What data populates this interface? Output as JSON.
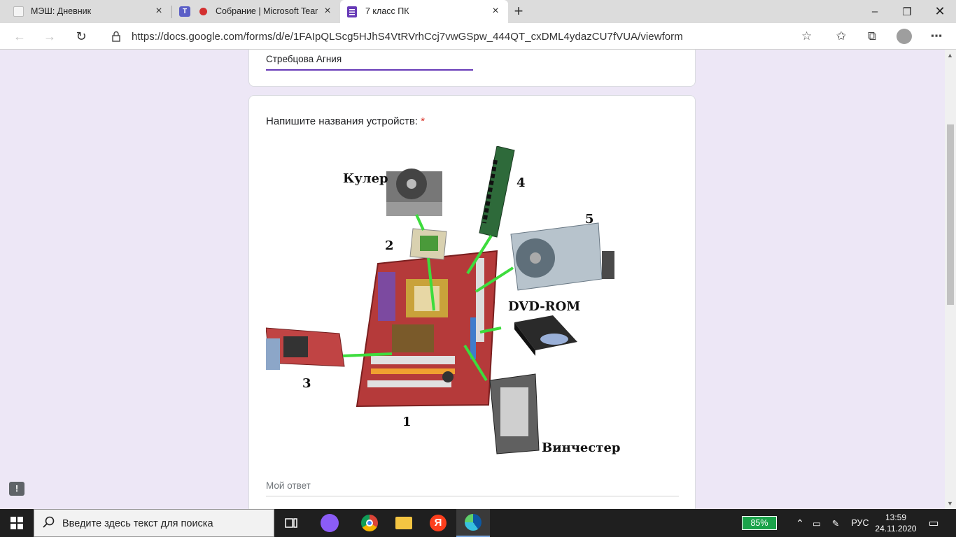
{
  "browser": {
    "tabs": [
      {
        "title": "МЭШ: Дневник"
      },
      {
        "title": "Собрание | Microsoft Teams"
      },
      {
        "title": "7 класс ПК"
      }
    ],
    "new_tab": "+",
    "address": "https://docs.google.com/forms/d/e/1FAIpQLScg5HJhS4VtRVrhCcj7vwGSpw_444QT_cxDML4ydazCU7fVUA/viewform"
  },
  "form": {
    "name_value": "Стребцова Агния",
    "question": "Напишите названия устройств:",
    "required_mark": "*",
    "answer_placeholder": "Мой ответ",
    "figure_labels": {
      "cooler": "Кулер",
      "n1": "1",
      "n2": "2",
      "n3": "3",
      "n4": "4",
      "n5": "5",
      "dvd": "DVD-ROM",
      "hdd": "Винчестер"
    }
  },
  "taskbar": {
    "search_placeholder": "Введите здесь текст для поиска",
    "battery": "85%",
    "language": "РУС",
    "time": "13:59",
    "date": "24.11.2020"
  },
  "colors": {
    "accent": "#673ab7",
    "page_bg": "#ede7f6",
    "required": "#d93025",
    "link_green": "#3ddc3d"
  }
}
